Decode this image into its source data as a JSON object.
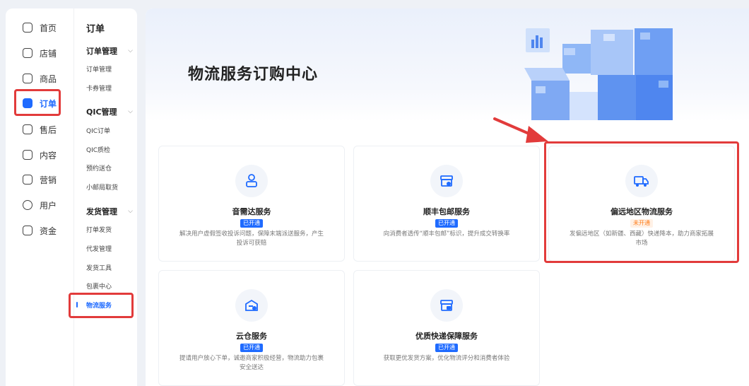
{
  "nav": {
    "items": [
      {
        "label": "首页"
      },
      {
        "label": "店铺"
      },
      {
        "label": "商品"
      },
      {
        "label": "订单"
      },
      {
        "label": "售后"
      },
      {
        "label": "内容"
      },
      {
        "label": "营销"
      },
      {
        "label": "用户"
      },
      {
        "label": "资金"
      }
    ]
  },
  "subnav": {
    "title": "订单",
    "groups": [
      {
        "label": "订单管理",
        "items": [
          "订单管理",
          "卡券管理"
        ]
      },
      {
        "label": "QIC管理",
        "items": [
          "QIC订单",
          "QIC质检",
          "预约送仓",
          "小邮局取货"
        ]
      },
      {
        "label": "发货管理",
        "items": [
          "打单发货",
          "代发管理",
          "发货工具",
          "包裹中心",
          "物流服务"
        ]
      }
    ]
  },
  "main": {
    "title": "物流服务订购中心",
    "cards": [
      {
        "title": "音需达服务",
        "status": "已开通",
        "desc": "解决用户虚假签收投诉问题，保障末端派送服务，产生投诉可获赔",
        "icon": "courier-icon"
      },
      {
        "title": "顺丰包邮服务",
        "status": "已开通",
        "desc": "向消费者透传“顺丰包邮”标识，提升成交转换率",
        "icon": "package-icon"
      },
      {
        "title": "偏远地区物流服务",
        "status": "未开通",
        "desc": "发偏远地区（如新疆、西藏）快递降本，助力商家拓展市场",
        "icon": "truck-icon"
      },
      {
        "title": "云仓服务",
        "status": "已开通",
        "desc": "提请用户放心下单，诚邀商家积极经营，物流助力包裹安全送达",
        "icon": "warehouse-icon"
      },
      {
        "title": "优质快递保障服务",
        "status": "已开通",
        "desc": "获取更优发货方案，优化物流评分和消费者体验",
        "icon": "thumbs-up-box-icon"
      }
    ]
  },
  "colors": {
    "accent": "#1f6bff",
    "highlight": "#e23b3b",
    "off": "#ff7d1a"
  }
}
